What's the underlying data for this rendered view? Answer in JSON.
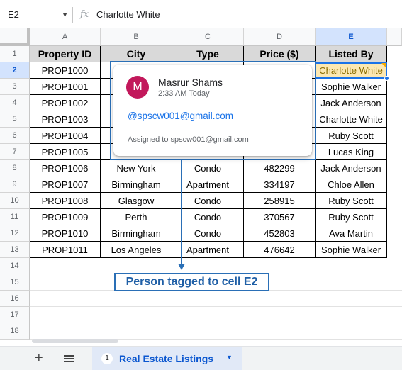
{
  "formula_bar": {
    "cell_ref": "E2",
    "fx_label": "fx",
    "value": "Charlotte White"
  },
  "grid": {
    "columns": [
      "A",
      "B",
      "C",
      "D",
      "E"
    ],
    "row_numbers": [
      "1",
      "2",
      "3",
      "4",
      "5",
      "6",
      "7",
      "8",
      "9",
      "10",
      "11",
      "12",
      "13",
      "14",
      "15",
      "16",
      "17",
      "18"
    ],
    "headers": [
      "Property ID",
      "City",
      "Type",
      "Price ($)",
      "Listed By"
    ],
    "rows": [
      [
        "PROP1000",
        "",
        "",
        "",
        "Charlotte White"
      ],
      [
        "PROP1001",
        "",
        "",
        "",
        "Sophie Walker"
      ],
      [
        "PROP1002",
        "",
        "",
        "",
        "Jack Anderson"
      ],
      [
        "PROP1003",
        "",
        "",
        "",
        "Charlotte White"
      ],
      [
        "PROP1004",
        "",
        "",
        "",
        "Ruby Scott"
      ],
      [
        "PROP1005",
        "",
        "",
        "",
        "Lucas King"
      ],
      [
        "PROP1006",
        "New York",
        "Condo",
        "482299",
        "Jack Anderson"
      ],
      [
        "PROP1007",
        "Birmingham",
        "Apartment",
        "334197",
        "Chloe Allen"
      ],
      [
        "PROP1008",
        "Glasgow",
        "Condo",
        "258915",
        "Ruby Scott"
      ],
      [
        "PROP1009",
        "Perth",
        "Condo",
        "370567",
        "Ruby Scott"
      ],
      [
        "PROP1010",
        "Birmingham",
        "Condo",
        "452803",
        "Ava Martin"
      ],
      [
        "PROP1011",
        "Los Angeles",
        "Apartment",
        "476642",
        "Sophie Walker"
      ]
    ],
    "selected_cell": "E2"
  },
  "comment_popup": {
    "avatar_initial": "M",
    "author": "Masrur Shams",
    "time": "2:33 AM Today",
    "mention": "@spscw001@gmail.com",
    "assigned": "Assigned to spscw001@gmail.com"
  },
  "annotation": {
    "label": "Person tagged to cell E2"
  },
  "sheet_tabs": {
    "add_icon": "+",
    "tab_number": "1",
    "active_tab": "Real Estate Listings"
  },
  "colors": {
    "accent": "#1a73e8",
    "highlight": "#fce8b2",
    "annotation": "#2a6fb6",
    "avatar": "#c2185b"
  }
}
